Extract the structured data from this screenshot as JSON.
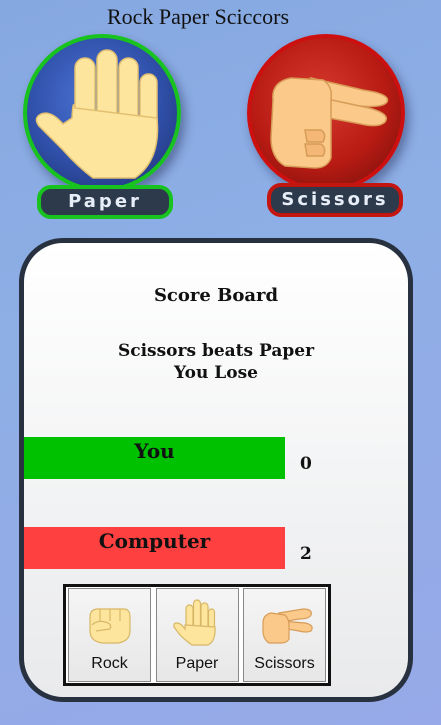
{
  "title": "Rock Paper Sciccors",
  "player": {
    "choice_label": "Paper",
    "ring_color": "#18c21f",
    "icon": "raised-hand-icon"
  },
  "computer": {
    "choice_label": "Scissors",
    "ring_color": "#cc1010",
    "icon": "scissors-hand-icon"
  },
  "scoreboard": {
    "title": "Score Board",
    "result_line_1": "Scissors beats Paper",
    "result_line_2": "You Lose",
    "you_label": "You",
    "you_score": "0",
    "you_bar_color": "#00c100",
    "computer_label": "Computer",
    "computer_score": "2",
    "computer_bar_color": "#ff4040"
  },
  "choices": [
    {
      "label": "Rock",
      "icon": "fist-icon"
    },
    {
      "label": "Paper",
      "icon": "raised-hand-icon"
    },
    {
      "label": "Scissors",
      "icon": "scissors-hand-icon"
    }
  ]
}
